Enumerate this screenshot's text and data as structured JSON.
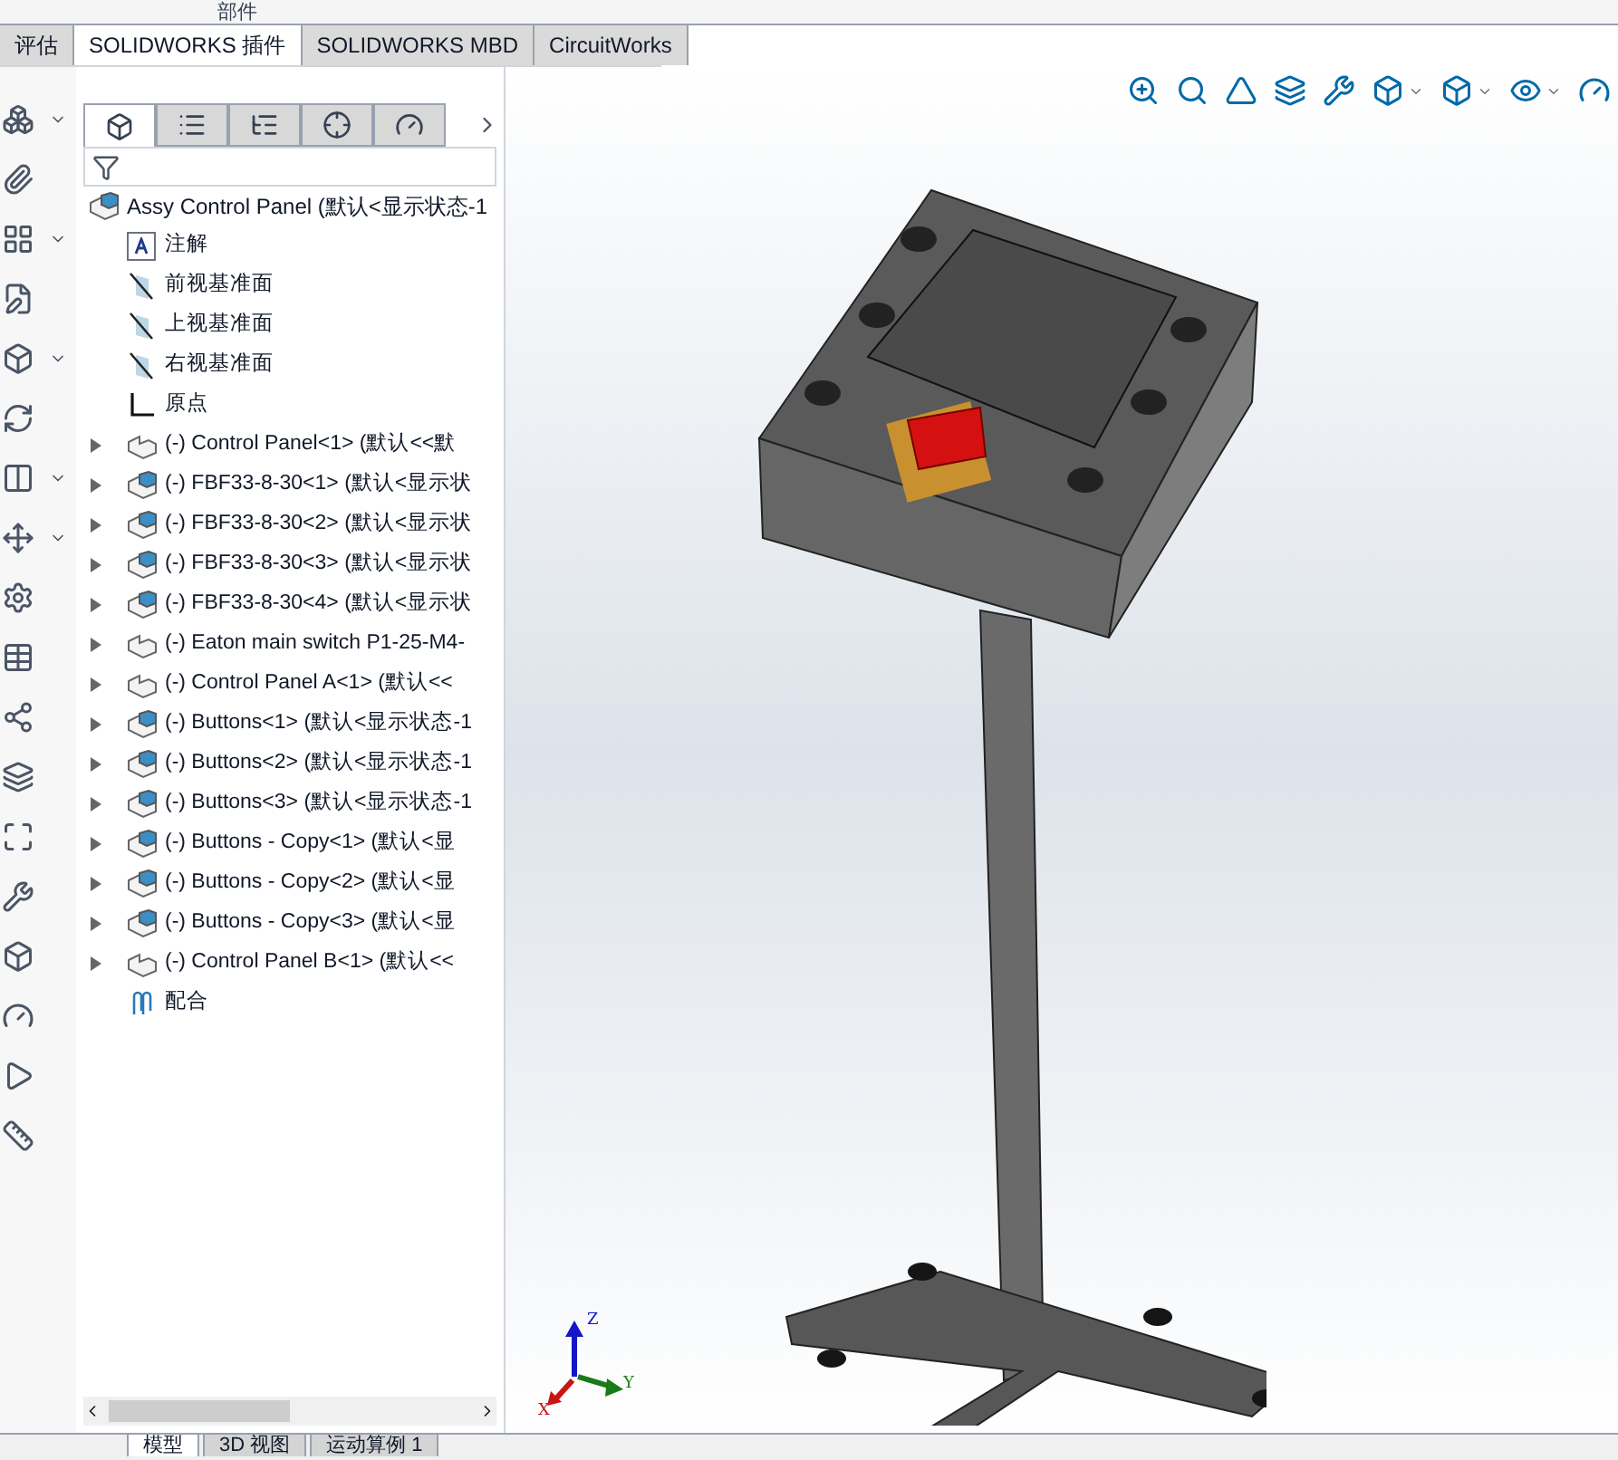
{
  "ribbon_top": {
    "label": "部件"
  },
  "command_tabs": [
    {
      "label": "评估",
      "selected": false
    },
    {
      "label": "SOLIDWORKS 插件",
      "selected": true
    },
    {
      "label": "SOLIDWORKS MBD",
      "selected": false
    },
    {
      "label": "CircuitWorks",
      "selected": false
    }
  ],
  "manager_tabs": [
    {
      "selected": true
    },
    {
      "selected": false
    },
    {
      "selected": false
    },
    {
      "selected": false
    },
    {
      "selected": false
    }
  ],
  "tree": {
    "root": "Assy Control Panel  (默认<显示状态-1",
    "items": [
      {
        "kind": "annotation",
        "label": "注解",
        "expandable": false
      },
      {
        "kind": "plane",
        "label": "前视基准面",
        "expandable": false
      },
      {
        "kind": "plane",
        "label": "上视基准面",
        "expandable": false
      },
      {
        "kind": "plane",
        "label": "右视基准面",
        "expandable": false
      },
      {
        "kind": "origin",
        "label": "原点",
        "expandable": false
      },
      {
        "kind": "part",
        "label": "(-) Control Panel<1> (默认<<默",
        "expandable": true
      },
      {
        "kind": "assembly",
        "label": "(-) FBF33-8-30<1> (默认<显示状",
        "expandable": true
      },
      {
        "kind": "assembly",
        "label": "(-) FBF33-8-30<2> (默认<显示状",
        "expandable": true
      },
      {
        "kind": "assembly",
        "label": "(-) FBF33-8-30<3> (默认<显示状",
        "expandable": true
      },
      {
        "kind": "assembly",
        "label": "(-) FBF33-8-30<4> (默认<显示状",
        "expandable": true
      },
      {
        "kind": "part",
        "label": "(-) Eaton main switch P1-25-M4-",
        "expandable": true
      },
      {
        "kind": "part",
        "label": "(-) Control Panel A<1> (默认<<",
        "expandable": true
      },
      {
        "kind": "assembly",
        "label": "(-) Buttons<1> (默认<显示状态-1",
        "expandable": true
      },
      {
        "kind": "assembly",
        "label": "(-) Buttons<2> (默认<显示状态-1",
        "expandable": true
      },
      {
        "kind": "assembly",
        "label": "(-) Buttons<3> (默认<显示状态-1",
        "expandable": true
      },
      {
        "kind": "assembly",
        "label": "(-) Buttons - Copy<1> (默认<显",
        "expandable": true
      },
      {
        "kind": "assembly",
        "label": "(-) Buttons - Copy<2> (默认<显",
        "expandable": true
      },
      {
        "kind": "assembly",
        "label": "(-) Buttons - Copy<3> (默认<显",
        "expandable": true
      },
      {
        "kind": "part",
        "label": "(-) Control Panel B<1> (默认<<",
        "expandable": true
      },
      {
        "kind": "mates",
        "label": "配合",
        "expandable": false
      }
    ]
  },
  "triad": {
    "z": "Z",
    "y": "Y",
    "x": "X"
  },
  "bottom_tabs": [
    {
      "label": "模型",
      "selected": true
    },
    {
      "label": "3D 视图",
      "selected": false
    },
    {
      "label": "运动算例 1",
      "selected": false
    }
  ]
}
